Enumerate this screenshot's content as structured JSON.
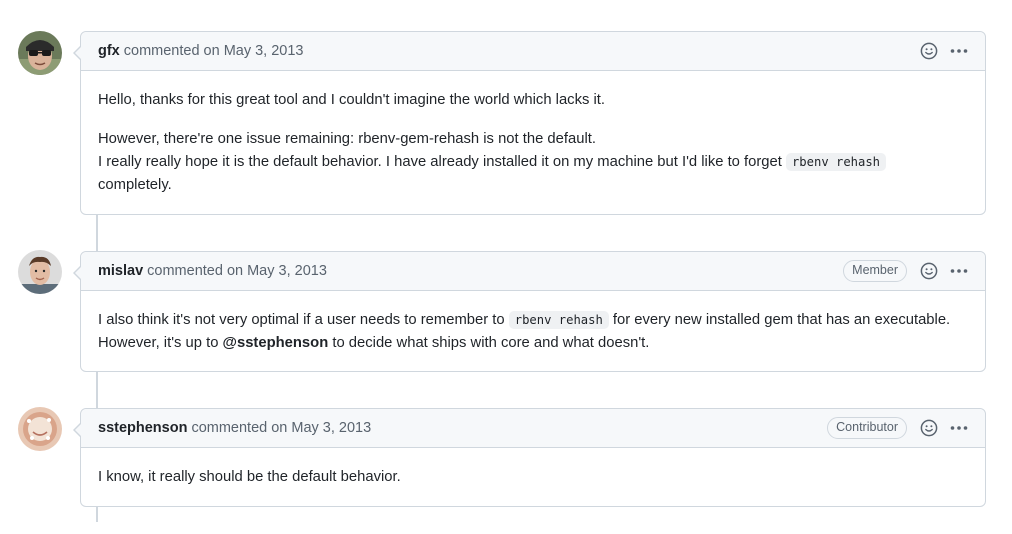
{
  "comments": [
    {
      "author": "gfx",
      "meta": "commented on May 3, 2013",
      "role": "",
      "body": {
        "p1": "Hello, thanks for this great tool and I couldn't imagine the world which lacks it.",
        "p2_line1": "However, there're one issue remaining: rbenv-gem-rehash is not the default.",
        "p2_line2_before": "I really really hope it is the default behavior. I have already installed it on my machine but I'd like to forget ",
        "p2_code": "rbenv rehash",
        "p2_line2_after": "completely."
      },
      "avatar_icon": "avatar-gfx-icon"
    },
    {
      "author": "mislav",
      "meta": "commented on May 3, 2013",
      "role": "Member",
      "body": {
        "before_code": "I also think it's not very optimal if a user needs to remember to ",
        "code": "rbenv rehash",
        "after_code": " for every new installed gem that has an executable. However, it's up to ",
        "mention": "@sstephenson",
        "after_mention": " to decide what ships with core and what doesn't."
      },
      "avatar_icon": "avatar-mislav-icon"
    },
    {
      "author": "sstephenson",
      "meta": "commented on May 3, 2013",
      "role": "Contributor",
      "body": {
        "p1": "I know, it really should be the default behavior."
      },
      "avatar_icon": "avatar-sstephenson-icon"
    }
  ],
  "icons": {
    "reaction": "smiley-icon",
    "menu": "kebab-horizontal-icon"
  },
  "colors": {
    "border": "#d0d7de",
    "header_bg": "#f6f8fa",
    "muted_text": "#59636e",
    "text": "#1f2328"
  }
}
